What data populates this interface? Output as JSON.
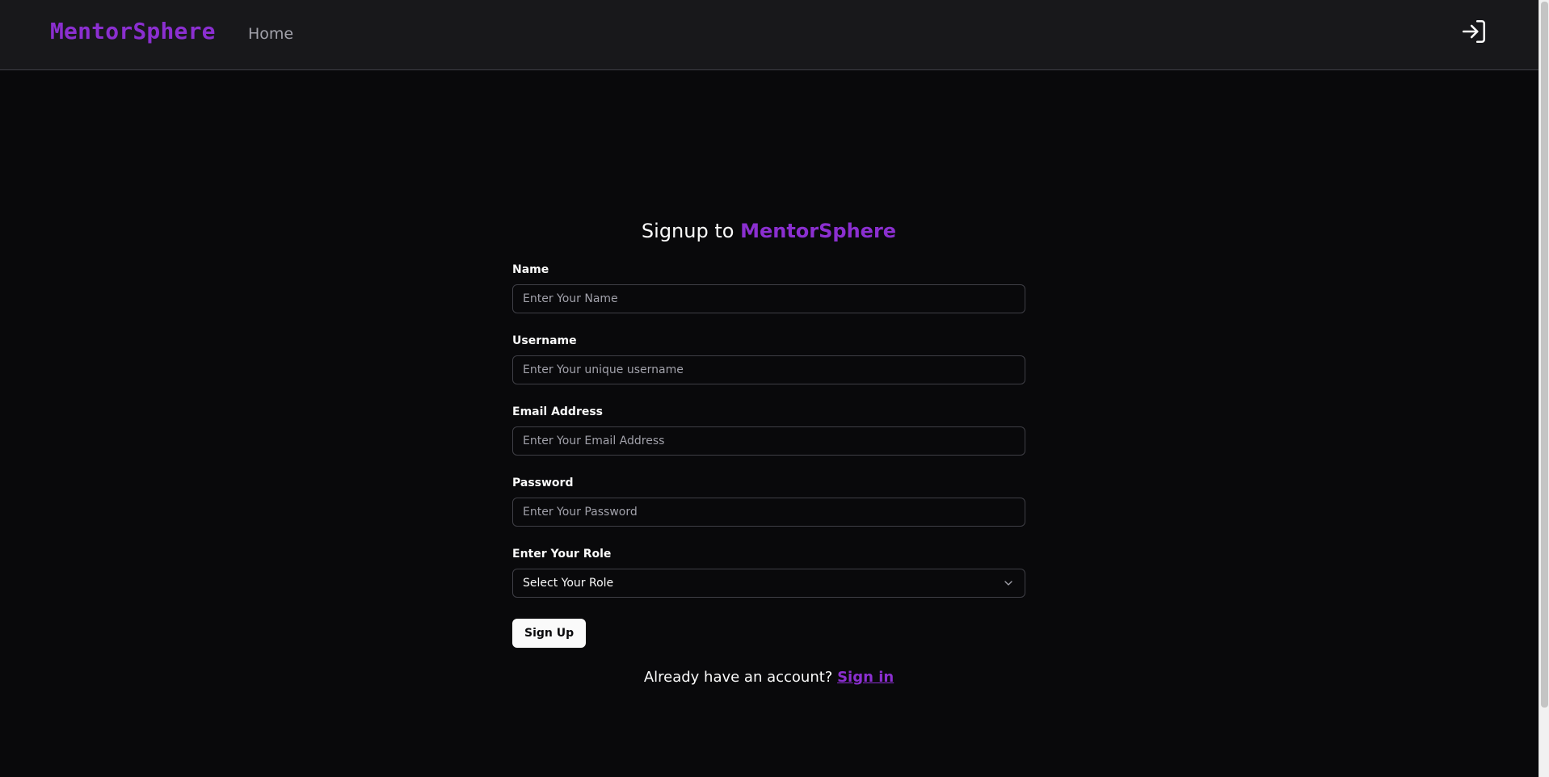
{
  "header": {
    "brand": "MentorSphere",
    "nav_home": "Home",
    "signin_icon": "sign-in-icon"
  },
  "form": {
    "title_prefix": "Signup to",
    "title_brand": "MentorSphere",
    "fields": [
      {
        "label": "Name",
        "placeholder": "Enter Your Name",
        "value": ""
      },
      {
        "label": "Username",
        "placeholder": "Enter Your unique username",
        "value": ""
      },
      {
        "label": "Email Address",
        "placeholder": "Enter Your Email Address",
        "value": ""
      },
      {
        "label": "Password",
        "placeholder": "Enter Your Password",
        "value": ""
      }
    ],
    "role": {
      "label": "Enter Your Role",
      "selected": "Select Your Role"
    },
    "submit_label": "Sign Up",
    "footer_text": "Already have an account?",
    "signin_link": "Sign in"
  },
  "colors": {
    "background": "#09090b",
    "header": "#18181b",
    "accent": "#8b2fd0",
    "border": "#3f3f46"
  }
}
